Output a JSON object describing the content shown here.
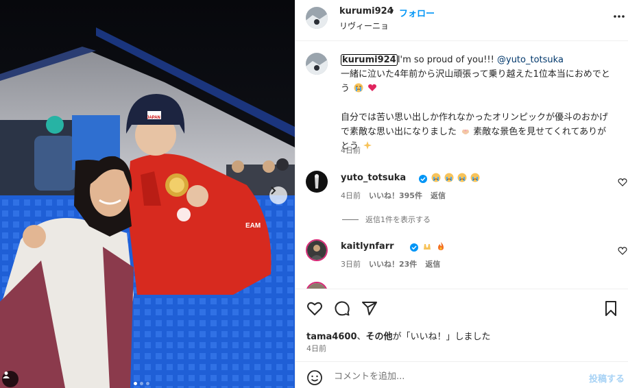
{
  "post": {
    "author": "kurumi924",
    "separator": "•",
    "follow_label": "フォロー",
    "subtitle": "リヴィーニョ",
    "more_icon": "more-horizontal-icon"
  },
  "photo": {
    "slide_count": 3,
    "active_slide": 1,
    "next_icon": "chevron-right-icon",
    "tag_icon": "user-tag-icon",
    "cap_text": "JAPAN",
    "jacket_text": "EAM"
  },
  "caption": {
    "user": "kurumi924",
    "text_1": "I'm so proud of you!!! ",
    "mention": "@yuto_totsuka",
    "text_2": "一緒に泣いた4年前から沢山頑張って乗り越えた1位本当におめでとう",
    "text_3": "自分では苦い思い出しか作れなかったオリンピックが優斗のおかげで素敵な思い出になりました",
    "text_4": "素敵な景色を見せてくれてありがとう",
    "time": "4日前"
  },
  "comments": [
    {
      "user": "yuto_totsuka",
      "verified": true,
      "time": "4日前",
      "likes": "いいね！395件",
      "reply_label": "返信",
      "view_replies": "返信1件を表示する"
    },
    {
      "user": "kaitlynfarr",
      "verified": true,
      "time": "3日前",
      "likes": "いいね！23件",
      "reply_label": "返信"
    }
  ],
  "actions": {
    "like_icon": "heart-icon",
    "comment_icon": "comment-icon",
    "share_icon": "share-icon",
    "save_icon": "bookmark-icon"
  },
  "likes_line": {
    "user": "tama4600",
    "mid": "、",
    "others": "その他",
    "suffix": "が「いいね！」しました"
  },
  "post_time": "4日前",
  "composer": {
    "emoji_icon": "emoji-icon",
    "placeholder": "コメントを追加...",
    "post_label": "投稿する"
  },
  "colors": {
    "accent": "#0095f6",
    "mention": "#00376b",
    "muted": "#737373",
    "verified": "#0095f6"
  }
}
